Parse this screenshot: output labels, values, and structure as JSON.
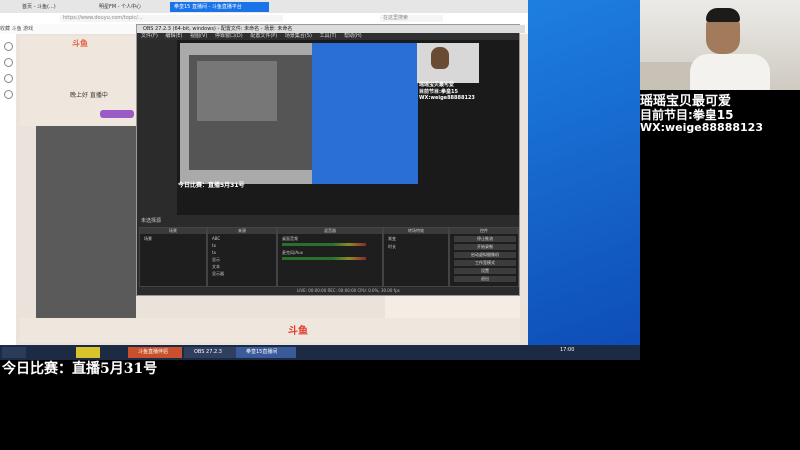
{
  "browser": {
    "tabs": [
      "首页 - 斗鱼(...)",
      "明星FM - 个人中心",
      "拳皇15 直播间 - 斗鱼直播平台"
    ],
    "address": "https://www.douyu.com/topic/...",
    "search_placeholder": "在这里搜索",
    "bookmarks": "收藏  斗鱼  游戏"
  },
  "site": {
    "logo": "斗鱼",
    "live_status": "晚上好 直播中",
    "brand": "斗鱼"
  },
  "obs": {
    "title": "OBS 27.2.3 (64-bit, windows) - 配置文件: 未命名 - 场景: 未命名",
    "menu": [
      "文件(F)",
      "编辑(E)",
      "视图(V)",
      "停靠窗口(D)",
      "配置文件(P)",
      "场景集合(S)",
      "工具(T)",
      "帮助(H)"
    ],
    "preview_caption_today": "今日比赛：直播5月31号",
    "preview_caption_a": "瑶瑶宝贝最可爱",
    "preview_caption_b": "目前节目:拳皇15",
    "preview_caption_c": "WX:weige88888123",
    "dock_title": "未选择源",
    "docks": {
      "scenes": {
        "header": "场景",
        "items": [
          "场景"
        ]
      },
      "sources": {
        "header": "来源",
        "items": [
          "ABC",
          "tx",
          "tx",
          "显示",
          "文本",
          "显示器"
        ]
      },
      "mixer": {
        "header": "混音器",
        "items": [
          "桌面音频",
          "麦克风/Aux"
        ]
      },
      "transitions": {
        "header": "转场特效",
        "items": [
          "渐变",
          "时长"
        ]
      },
      "controls": {
        "header": "控件",
        "buttons": [
          "停止推流",
          "开始录制",
          "启动虚拟摄像机",
          "工作室模式",
          "设置",
          "退出"
        ]
      }
    },
    "status": "LIVE: 00:00:00   REC: 00:00:00   CPU: 0.0%, 30.00 fps"
  },
  "taskbar": {
    "items": [
      "",
      "",
      "",
      "斗鱼直播伴侣",
      "OBS 27.2.3",
      "拳皇15直播间"
    ],
    "time": "17:00"
  },
  "overlay": {
    "line1": "瑶瑶宝贝最可爱",
    "line2": "目前节目:拳皇15",
    "line3": "WX:weige88888123",
    "bottom": "今日比赛：直播5月31号"
  }
}
